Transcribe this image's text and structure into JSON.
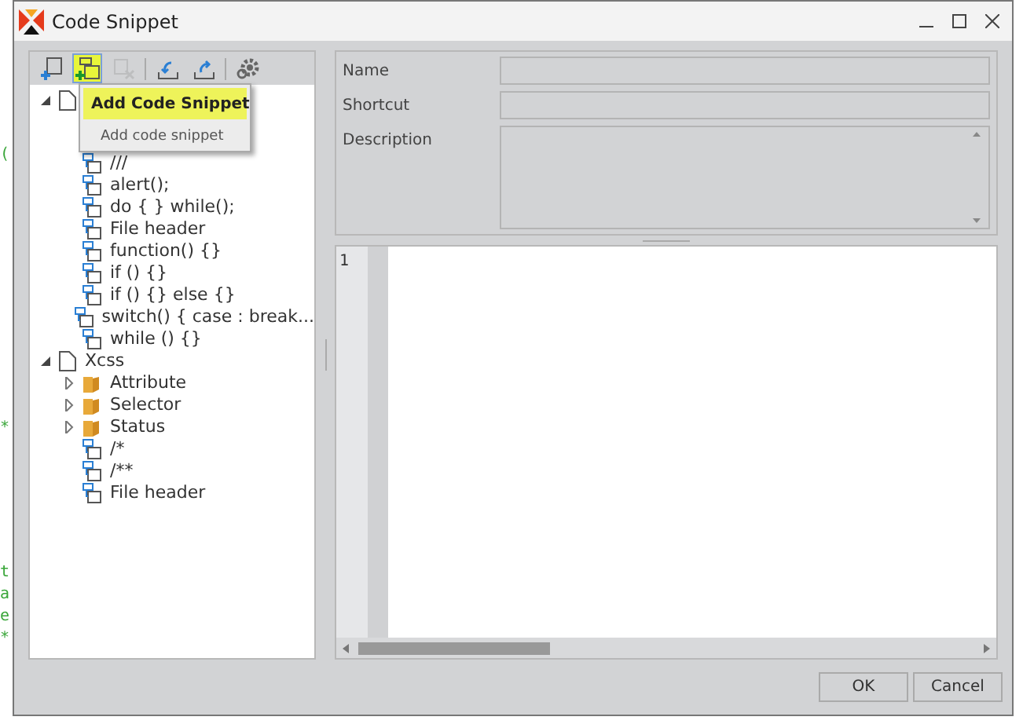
{
  "background_editor": {
    "lines": [
      "(",
      "*",
      "t",
      "a",
      "e",
      "*"
    ]
  },
  "window": {
    "title": "Code Snippet"
  },
  "toolbar": [
    {
      "kind": "new",
      "highlighted": false,
      "disabled": false
    },
    {
      "kind": "add",
      "highlighted": true,
      "disabled": false
    },
    {
      "kind": "delete",
      "highlighted": false,
      "disabled": true
    },
    {
      "kind": "import",
      "highlighted": false,
      "disabled": false
    },
    {
      "kind": "export",
      "highlighted": false,
      "disabled": false
    },
    {
      "kind": "settings",
      "highlighted": false,
      "disabled": false
    }
  ],
  "tooltip": {
    "title": "Add Code Snippet",
    "text": "Add code snippet"
  },
  "tree": [
    {
      "kind": "file",
      "expanded": true,
      "children": [
        {
          "kind": "snippet",
          "label": "///"
        },
        {
          "kind": "snippet",
          "label": "alert();"
        },
        {
          "kind": "snippet",
          "label": "do { } while();"
        },
        {
          "kind": "snippet",
          "label": "File header"
        },
        {
          "kind": "snippet",
          "label": "function() {}"
        },
        {
          "kind": "snippet",
          "label": "if () {}"
        },
        {
          "kind": "snippet",
          "label": "if () {} else {}"
        },
        {
          "kind": "snippet",
          "label": "switch() { case : break..."
        },
        {
          "kind": "snippet",
          "label": "while () {}"
        }
      ]
    },
    {
      "kind": "file",
      "label": "Xcss",
      "expanded": true,
      "children": [
        {
          "kind": "folder",
          "label": "Attribute",
          "expanded": false
        },
        {
          "kind": "folder",
          "label": "Selector",
          "expanded": false
        },
        {
          "kind": "folder",
          "label": "Status",
          "expanded": false
        },
        {
          "kind": "snippet",
          "label": "/*"
        },
        {
          "kind": "snippet",
          "label": "/**"
        },
        {
          "kind": "snippet",
          "label": "File header"
        }
      ]
    }
  ],
  "form": {
    "fields": [
      {
        "label": "Name",
        "kind": "line"
      },
      {
        "label": "Shortcut",
        "kind": "line"
      },
      {
        "label": "Description",
        "kind": "area"
      }
    ]
  },
  "editor": {
    "line_numbers": [
      "1"
    ]
  },
  "buttons": [
    "OK",
    "Cancel"
  ]
}
